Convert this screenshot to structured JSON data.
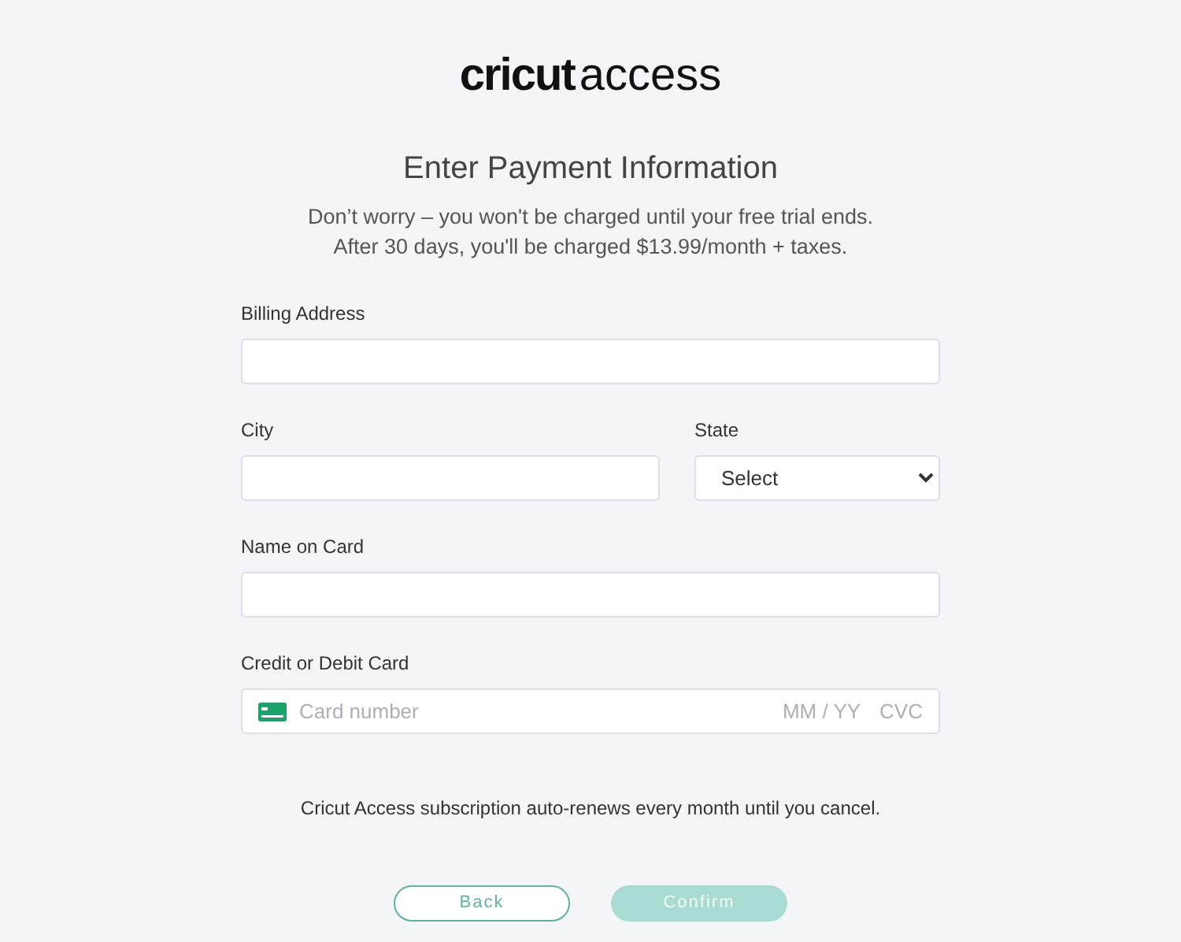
{
  "logo": {
    "brand": "cricut",
    "product": "access"
  },
  "title": "Enter Payment Information",
  "subtitle": [
    "Don’t worry – you won't be charged until your free trial ends.",
    "After 30 days, you'll be charged $13.99/month + taxes."
  ],
  "field_rows": [
    [
      {
        "kind": "text",
        "label": "Billing Address"
      }
    ],
    [
      {
        "kind": "text",
        "label": "City"
      },
      {
        "kind": "select",
        "label": "State",
        "value": "Select"
      }
    ],
    [
      {
        "kind": "text",
        "label": "Name on Card"
      }
    ],
    [
      {
        "kind": "card",
        "label": "Credit or Debit Card",
        "placeholder": "Card number",
        "expiry_placeholder": "MM / YY",
        "cvc_placeholder": "CVC"
      }
    ]
  ],
  "notice": "Cricut Access subscription auto-renews every month until you cancel.",
  "buttons": [
    {
      "label": "Back",
      "kind": "outline",
      "disabled": false
    },
    {
      "label": "Confirm",
      "kind": "filled",
      "disabled": true
    }
  ]
}
